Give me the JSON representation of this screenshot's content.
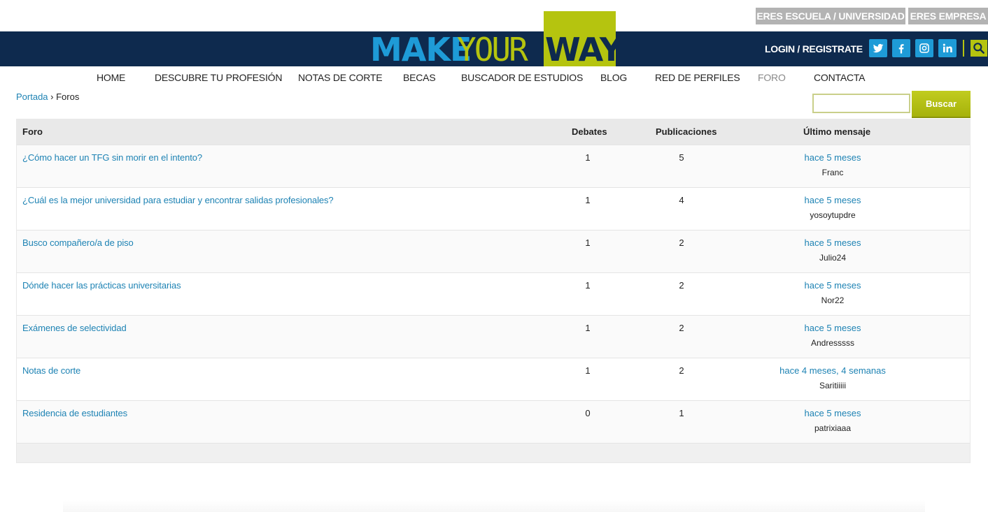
{
  "utility": {
    "school_label": "ERES ESCUELA / UNIVERSIDAD",
    "company_label": "ERES EMPRESA"
  },
  "logo": {
    "make": "MAKE",
    "your": "YOUR",
    "way": "WAY"
  },
  "header": {
    "login_label": "LOGIN / REGISTRATE",
    "socials": [
      {
        "name": "twitter-icon",
        "glyph": "t"
      },
      {
        "name": "facebook-icon",
        "glyph": "f"
      },
      {
        "name": "instagram-icon",
        "glyph": ""
      },
      {
        "name": "linkedin-icon",
        "glyph": "in"
      }
    ]
  },
  "nav": [
    {
      "label": "HOME"
    },
    {
      "label": "DESCUBRE TU PROFESIÓN"
    },
    {
      "label": "NOTAS DE CORTE"
    },
    {
      "label": "BECAS"
    },
    {
      "label": "BUSCADOR DE ESTUDIOS"
    },
    {
      "label": "BLOG"
    },
    {
      "label": "RED DE PERFILES"
    },
    {
      "label": "FORO",
      "active": true
    },
    {
      "label": "CONTACTA"
    }
  ],
  "breadcrumb": {
    "home": "Portada",
    "separator": " › ",
    "current": "Foros"
  },
  "search": {
    "value": "",
    "button_label": "Buscar"
  },
  "table": {
    "headers": {
      "forum": "Foro",
      "topics": "Debates",
      "posts": "Publicaciones",
      "last": "Último mensaje"
    },
    "rows": [
      {
        "title": "¿Cómo hacer un TFG sin morir en el intento?",
        "topics": "1",
        "posts": "5",
        "last_time": "hace 5 meses",
        "last_user": "Franc"
      },
      {
        "title": "¿Cuál es la mejor universidad para estudiar y encontrar salidas profesionales?",
        "topics": "1",
        "posts": "4",
        "last_time": "hace 5 meses",
        "last_user": "yosoytupdre"
      },
      {
        "title": "Busco compañero/a de piso",
        "topics": "1",
        "posts": "2",
        "last_time": "hace 5 meses",
        "last_user": "Julio24"
      },
      {
        "title": "Dónde hacer las prácticas universitarias",
        "topics": "1",
        "posts": "2",
        "last_time": "hace 5 meses",
        "last_user": "Nor22"
      },
      {
        "title": "Exámenes de selectividad",
        "topics": "1",
        "posts": "2",
        "last_time": "hace 5 meses",
        "last_user": "Andresssss"
      },
      {
        "title": "Notas de corte",
        "topics": "1",
        "posts": "2",
        "last_time": "hace 4 meses, 4 semanas",
        "last_user": "Saritiiiii"
      },
      {
        "title": "Residencia de estudiantes",
        "topics": "0",
        "posts": "1",
        "last_time": "hace 5 meses",
        "last_user": "patrixiaaa"
      }
    ]
  },
  "colors": {
    "navy": "#0e2a4e",
    "lime": "#b5c40f",
    "blue": "#1e9bd7",
    "link": "#1e83b4"
  }
}
